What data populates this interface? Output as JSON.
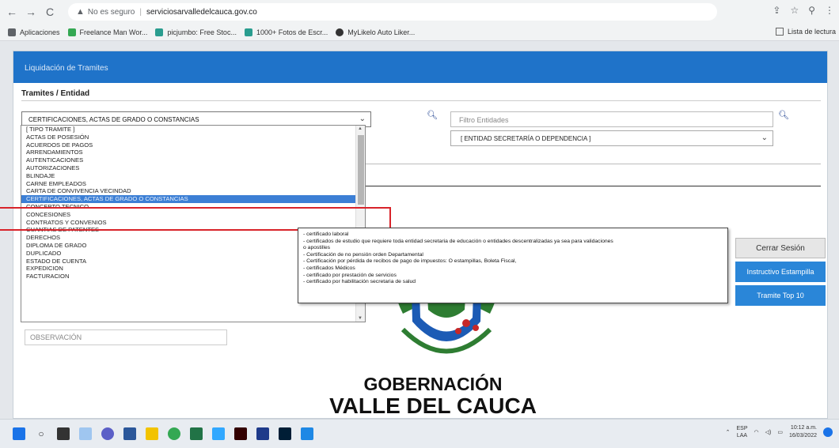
{
  "browser": {
    "nav_back": "←",
    "nav_forward": "→",
    "nav_reload": "C",
    "security_label": "No es seguro",
    "url": "serviciosarvalledelcauca.gov.co",
    "bookmarks": [
      {
        "label": "Aplicaciones",
        "color": "#5f6368"
      },
      {
        "label": "Freelance Man Wor...",
        "color": "#34a853"
      },
      {
        "label": "picjumbo: Free Stoc...",
        "color": "#2a9d8f"
      },
      {
        "label": "1000+ Fotos de Escr...",
        "color": "#2a9d8f"
      },
      {
        "label": "MyLikelo Auto Liker...",
        "color": "#333333"
      }
    ],
    "reading_list": "Lista de lectura"
  },
  "panel": {
    "header": "Liquidación de Tramites",
    "section_title": "Tramites / Entidad",
    "tramite_selected": "CERTIFICACIONES, ACTAS DE GRADO O CONSTANCIAS",
    "filter_placeholder": "Filtro Entidades",
    "entity_selected": "[ ENTIDAD SECRETARÍA O DEPENDENCIA ]",
    "observation_placeholder": "OBSERVACIÓN"
  },
  "dropdown": {
    "items": [
      "[ TIPO TRAMITE ]",
      "ACTAS DE POSESIÓN",
      "ACUERDOS DE PAGOS",
      "ARRENDAMIENTOS",
      "AUTENTICACIONES",
      "AUTORIZACIONES",
      "BLINDAJE",
      "CARNE EMPLEADOS",
      "CARTA DE CONVIVENCIA VECINDAD",
      "CERTIFICACIONES, ACTAS DE GRADO O CONSTANCIAS",
      "CONCEPTO TECNICO",
      "CONCESIONES",
      "CONTRATOS Y CONVENIOS",
      "CUANTIAS DE PATENTES",
      "DERECHOS",
      "DIPLOMA DE GRADO",
      "DUPLICADO",
      "ESTADO DE CUENTA",
      "EXPEDICION",
      "FACTURACION"
    ],
    "selected_index": 9
  },
  "tooltip": {
    "lines": [
      "- certificado laboral",
      "- certificados de estudio que requiere toda entidad secretaria de educación o entidades descentralizadas ya sea para validaciones",
      "o apostilles",
      "- Certificación de no pensión orden Departamental",
      "- Certificación por pérdida de recibos de pago de impuestos: O estampillas, Boleta Fiscal,",
      "- certificados Médicos",
      "- certificado por prestación de servicios",
      "- certificado por habilitación secretaria de salud"
    ]
  },
  "buttons": {
    "logout": "Cerrar Sesión",
    "instructivo": "Instructivo Estampilla",
    "top10": "Tramite Top 10"
  },
  "brand": {
    "line1": "GOBERNACIÓN",
    "line2": "VALLE DEL CAUCA"
  },
  "taskbar": {
    "lang_1": "ESP",
    "lang_2": "LAA",
    "time": "10:12 a.m.",
    "date": "16/03/2022"
  },
  "colors": {
    "header_blue": "#1f73c9",
    "button_blue": "#2a86d8",
    "highlight_red": "#d8232a",
    "selected_item": "#3c7fd5"
  }
}
